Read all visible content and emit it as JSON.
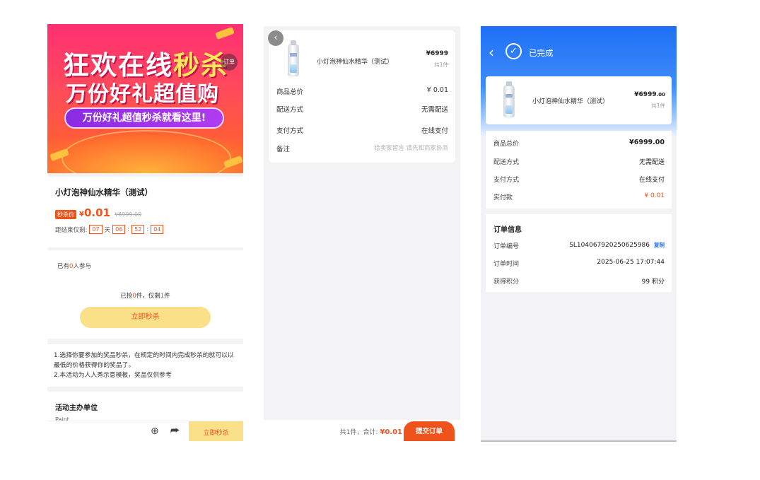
{
  "flash_sale": {
    "banner": {
      "line1_a": "狂欢在线",
      "line1_b": "秒杀",
      "line2": "万份好礼超值购",
      "pill": "万份好礼超值秒杀就看这里!",
      "order_tag": "订单"
    },
    "product_title": "小灯泡神仙水精华（测试）",
    "sale_badge": "秒杀价",
    "price_symbol": "¥",
    "price": "0.01",
    "original_price": "¥6999.00",
    "countdown_label": "距结束仅剩:",
    "countdown": {
      "days": "07",
      "day_unit": "天",
      "hours": "06",
      "minutes": "52",
      "seconds": "04"
    },
    "joined_prefix": "已有",
    "joined_count": "0",
    "joined_suffix": "人参与",
    "grabbed_prefix": "已抢",
    "grabbed_count": "0",
    "grabbed_mid": "件，仅剩",
    "remaining_count": "1",
    "grabbed_suffix": "件",
    "buy_button": "立即秒杀",
    "rules_1": "1.选择你要参加的奖品秒杀，在规定的时间内完成秒杀的就可以以最低的价格获得你的奖品了。",
    "rules_2": "2.本活动为人人秀示意模板，奖品仅供参考",
    "organizer_heading": "活动主办单位",
    "organizer_name": "Paint...",
    "bottom_button": "立即秒杀"
  },
  "confirm_order": {
    "product_name": "小灯泡神仙水精华（测试）",
    "price": "¥6999",
    "qty": "共1件",
    "rows": [
      {
        "label": "商品总价",
        "value": "¥ 0.01"
      },
      {
        "label": "配送方式",
        "value": "无需配送"
      },
      {
        "label": "支付方式",
        "value": "在线支付"
      },
      {
        "label": "备注",
        "placeholder": "给卖家留言 请先和商家协商"
      }
    ],
    "total_prefix": "共1件，合计:",
    "total_value": "¥0.01",
    "submit_button": "提交订单"
  },
  "completed_order": {
    "title": "已完成",
    "product_name": "小灯泡神仙水精华（测试）",
    "price_main": "¥6999",
    "price_decimal": ".00",
    "qty": "共1件",
    "summary": [
      {
        "label": "商品总价",
        "value": "¥6999.00"
      },
      {
        "label": "配送方式",
        "value": "无需配送"
      },
      {
        "label": "支付方式",
        "value": "在线支付"
      },
      {
        "label": "实付款",
        "value": "¥ 0.01"
      }
    ],
    "info_title": "订单信息",
    "order_no_label": "订单编号",
    "order_no": "SL104067920250625986",
    "copy": "复制",
    "order_time_label": "订单时间",
    "order_time": "2025-06-25 17:07:44",
    "points_label": "获得积分",
    "points": "99 积分"
  },
  "colors": {
    "accent": "#f0521c",
    "blue": "#1e6ff6",
    "button_yellow": "#fbe08a"
  }
}
